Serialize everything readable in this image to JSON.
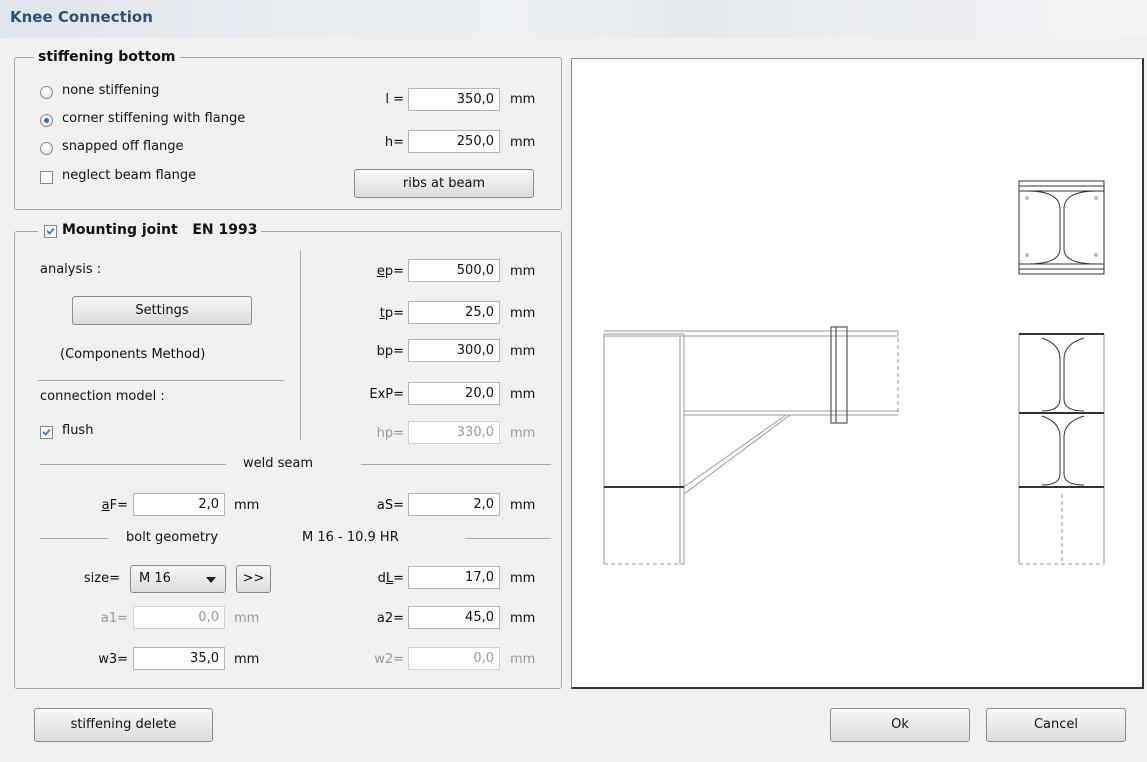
{
  "window": {
    "title": "Knee Connection"
  },
  "stiffening_bottom": {
    "legend": "stiffening bottom",
    "options": [
      {
        "label": "none stiffening",
        "selected": false
      },
      {
        "label": "corner stiffening with flange",
        "selected": true
      },
      {
        "label": "snapped off flange",
        "selected": false
      }
    ],
    "neglect_beam_flange": {
      "label": "neglect beam flange",
      "checked": false
    },
    "l": {
      "label": "l =",
      "value": "350,0",
      "unit": "mm"
    },
    "h": {
      "label": "h=",
      "value": "250,0",
      "unit": "mm"
    },
    "ribs_button": "ribs at beam"
  },
  "mounting_joint": {
    "legend": "Mounting joint   EN 1993",
    "checked": true,
    "analysis_label": "analysis :",
    "settings_button": "Settings",
    "method": "(Components Method)",
    "connection_model_label": "connection model :",
    "flush": {
      "label": "flush",
      "checked": true
    },
    "ep": {
      "label": "ep=",
      "value": "500,0",
      "unit": "mm"
    },
    "tp": {
      "label": "tp=",
      "value": "25,0",
      "unit": "mm"
    },
    "bp": {
      "label": "bp=",
      "value": "300,0",
      "unit": "mm"
    },
    "exp": {
      "label": "ExP=",
      "value": "20,0",
      "unit": "mm"
    },
    "hp": {
      "label": "hp=",
      "value": "330,0",
      "unit": "mm"
    },
    "weld_seam_label": "weld seam",
    "aF": {
      "label": "aF=",
      "value": "2,0",
      "unit": "mm"
    },
    "aS": {
      "label": "aS=",
      "value": "2,0",
      "unit": "mm"
    },
    "bolt_geometry_label": "bolt geometry",
    "bolt_spec": "M 16 - 10.9 HR",
    "size": {
      "label": "size=",
      "value": "M 16",
      "more_button": ">>"
    },
    "dL": {
      "label": "dL=",
      "value": "17,0",
      "unit": "mm"
    },
    "a1": {
      "label": "a1=",
      "value": "0,0",
      "unit": "mm"
    },
    "a2": {
      "label": "a2=",
      "value": "45,0",
      "unit": "mm"
    },
    "w3": {
      "label": "w3=",
      "value": "35,0",
      "unit": "mm"
    },
    "w2": {
      "label": "w2=",
      "value": "0,0",
      "unit": "mm"
    }
  },
  "buttons": {
    "stiffening_delete": "stiffening delete",
    "ok": "Ok",
    "cancel": "Cancel"
  }
}
